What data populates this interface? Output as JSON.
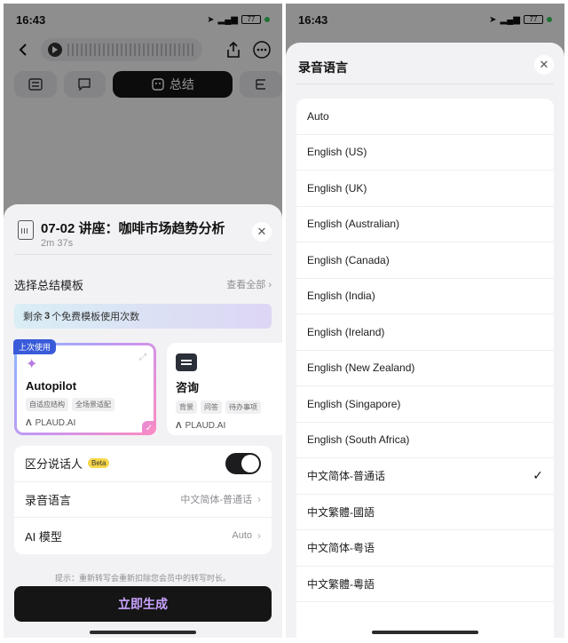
{
  "status_bar": {
    "time": "16:43",
    "battery": "77"
  },
  "left": {
    "tabs": {
      "summary_label": "总结"
    },
    "sheet": {
      "title": "07-02 讲座：咖啡市场趋势分析",
      "duration": "2m 37s",
      "template_section": {
        "title": "选择总结模板",
        "view_all": "查看全部"
      },
      "banner": {
        "prefix": "剩余",
        "count": "3",
        "suffix": "个免费模板使用次数"
      },
      "cards": [
        {
          "badge": "上次使用",
          "name": "Autopilot",
          "tags": [
            "自适应结构",
            "全场景适配"
          ],
          "brand": "PLAUD.AI",
          "selected": true
        },
        {
          "name": "咨询",
          "tags": [
            "背景",
            "问答",
            "待办事项"
          ],
          "brand": "PLAUD.AI",
          "selected": false
        }
      ],
      "settings": [
        {
          "label": "区分说话人",
          "badge": "Beta",
          "toggle_on": true
        },
        {
          "label": "录音语言",
          "value": "中文简体-普通话"
        },
        {
          "label": "AI 模型",
          "value": "Auto"
        }
      ],
      "hint": "提示：重新转写会重新扣除您会员中的转写时长。",
      "generate_label": "立即生成"
    }
  },
  "right": {
    "title": "录音语言",
    "languages": [
      {
        "label": "Auto",
        "selected": false
      },
      {
        "label": "English (US)",
        "selected": false
      },
      {
        "label": "English (UK)",
        "selected": false
      },
      {
        "label": "English (Australian)",
        "selected": false
      },
      {
        "label": "English (Canada)",
        "selected": false
      },
      {
        "label": "English (India)",
        "selected": false
      },
      {
        "label": "English (Ireland)",
        "selected": false
      },
      {
        "label": "English (New Zealand)",
        "selected": false
      },
      {
        "label": "English (Singapore)",
        "selected": false
      },
      {
        "label": "English (South Africa)",
        "selected": false
      },
      {
        "label": "中文简体-普通话",
        "selected": true
      },
      {
        "label": "中文繁體-國語",
        "selected": false
      },
      {
        "label": "中文简体-粤语",
        "selected": false
      },
      {
        "label": "中文繁體-粵語",
        "selected": false
      }
    ]
  },
  "colors": {
    "accent_purple": "#c9a4ff",
    "badge_blue": "#3a5bd9",
    "beta_yellow": "#f6d64a"
  }
}
